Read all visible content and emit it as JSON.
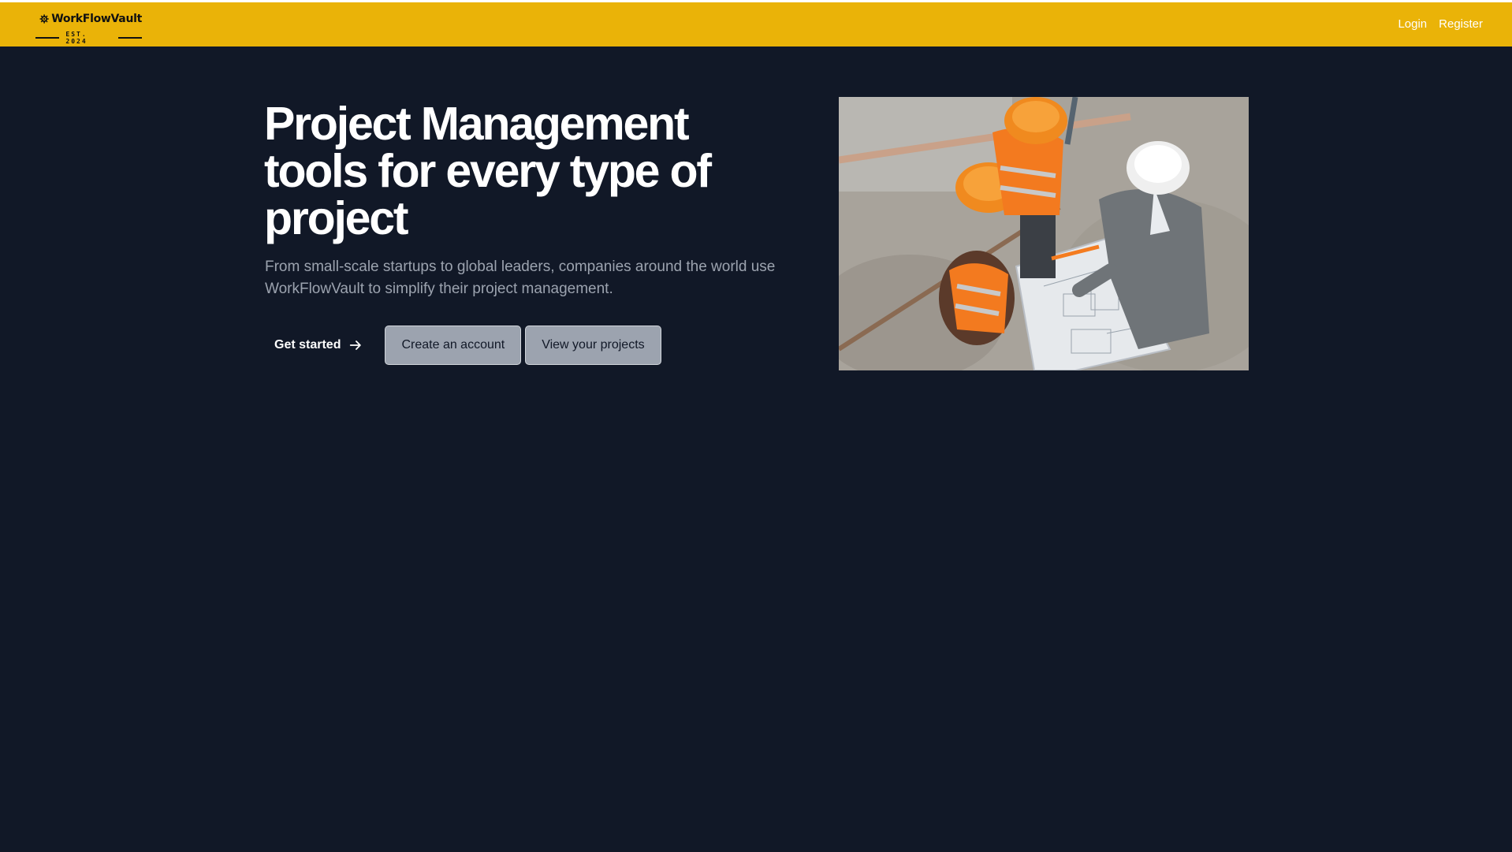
{
  "header": {
    "logo": {
      "name": "WorkFlowVault",
      "tagline": "EST. 2024"
    },
    "nav": [
      {
        "label": "Login"
      },
      {
        "label": "Register"
      }
    ]
  },
  "hero": {
    "title": "Project Management tools for every type of project",
    "subtitle": "From small-scale startups to global leaders, companies around the world use WorkFlowVault to simplify their project management.",
    "actions": {
      "get_started": "Get started",
      "create_account": "Create an account",
      "view_projects": "View your projects"
    }
  },
  "colors": {
    "brand": "#eab308",
    "background": "#111827",
    "muted_text": "#9ca3af",
    "secondary_button": "#9ca3af"
  },
  "icons": {
    "logo": "gear-icon",
    "get_started": "arrow-right-icon"
  }
}
